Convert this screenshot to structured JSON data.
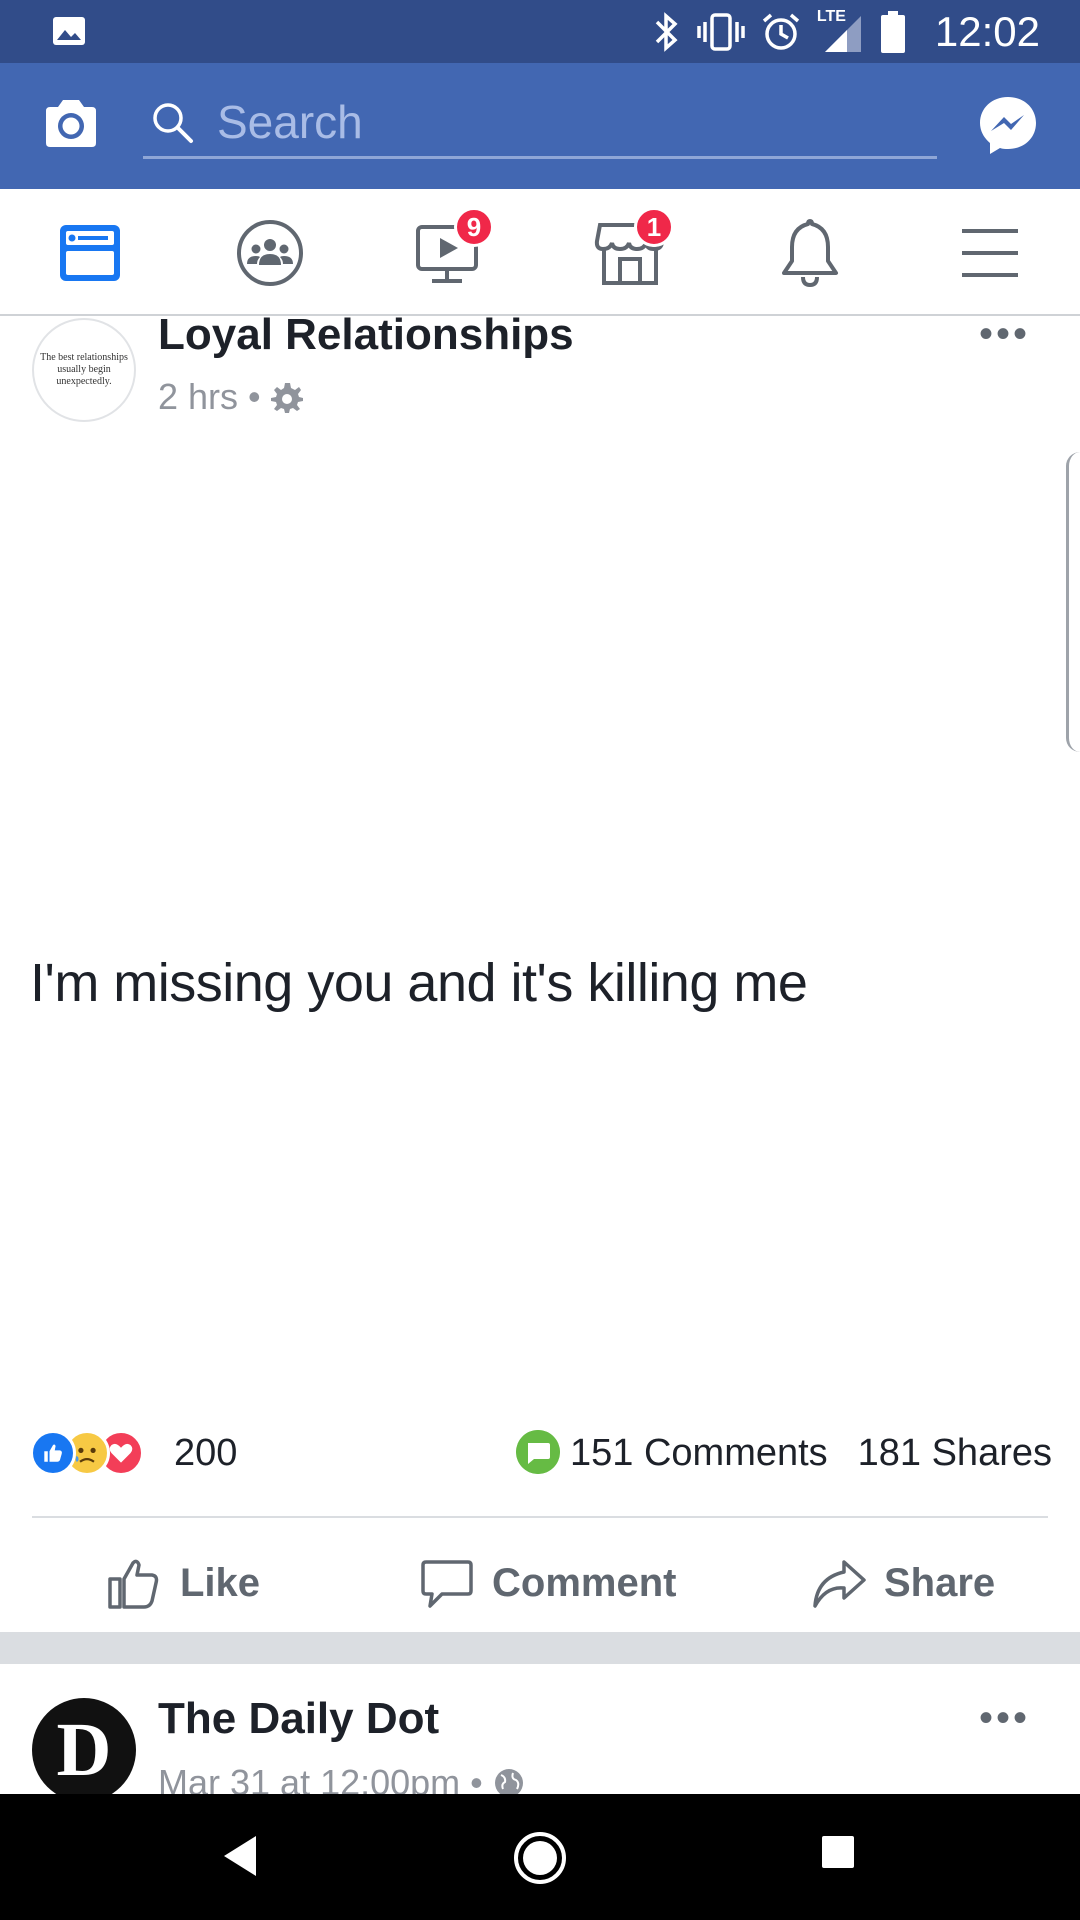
{
  "status_bar": {
    "time": "12:02",
    "network": "LTE",
    "icons": [
      "image-icon",
      "bluetooth-icon",
      "vibrate-icon",
      "alarm-icon",
      "signal-icon",
      "battery-icon"
    ]
  },
  "top_bar": {
    "search_placeholder": "Search",
    "colors": {
      "bar": "#4267b2",
      "status": "#314c89"
    }
  },
  "nav_tabs": [
    {
      "name": "news-feed",
      "icon": "newsfeed-icon",
      "active": true
    },
    {
      "name": "groups",
      "icon": "groups-icon"
    },
    {
      "name": "watch",
      "icon": "video-icon",
      "badge": "9"
    },
    {
      "name": "marketplace",
      "icon": "marketplace-icon",
      "badge": "1"
    },
    {
      "name": "notifications",
      "icon": "bell-icon"
    },
    {
      "name": "menu",
      "icon": "hamburger-icon"
    }
  ],
  "posts": [
    {
      "page_name": "Loyal Relationships",
      "avatar_text": "The best relationships usually begin unexpectedly.",
      "time": "2 hrs",
      "text": "I'm missing you and it's killing me",
      "reaction_count": "200",
      "comments": "151 Comments",
      "shares": "181 Shares",
      "actions": {
        "like": "Like",
        "comment": "Comment",
        "share": "Share"
      }
    },
    {
      "page_name": "The Daily Dot",
      "avatar_letter": "D",
      "time": "Mar 31 at 12:00pm"
    }
  ]
}
